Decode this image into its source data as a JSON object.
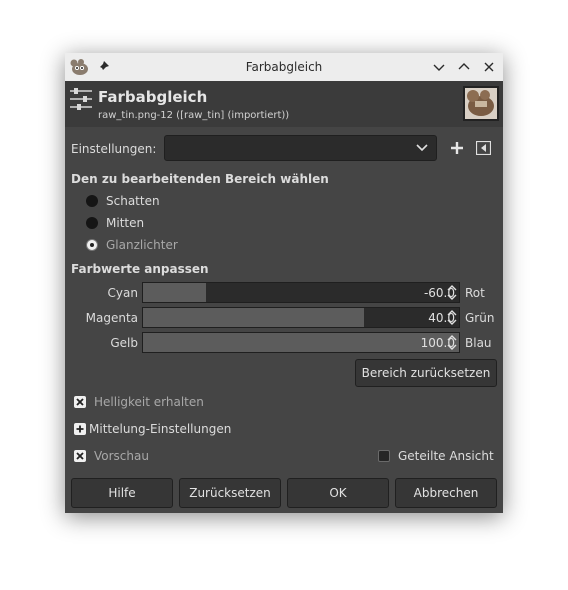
{
  "window": {
    "title": "Farbabgleich"
  },
  "header": {
    "title": "Farbabgleich",
    "subtitle": "raw_tin.png-12 ([raw_tin] (importiert))"
  },
  "presets": {
    "label": "Einstellungen:",
    "value": ""
  },
  "range": {
    "heading": "Den zu bearbeitenden Bereich wählen",
    "options": [
      "Schatten",
      "Mitten",
      "Glanzlichter"
    ],
    "selected": "Glanzlichter"
  },
  "levels": {
    "heading": "Farbwerte anpassen",
    "sliders": [
      {
        "left": "Cyan",
        "right": "Rot",
        "value": "-60.0",
        "fraction": 0.2
      },
      {
        "left": "Magenta",
        "right": "Grün",
        "value": "40.0",
        "fraction": 0.7
      },
      {
        "left": "Gelb",
        "right": "Blau",
        "value": "100.0",
        "fraction": 1.0
      }
    ],
    "reset_range": "Bereich zurücksetzen"
  },
  "options": {
    "preserve_luminosity": {
      "label": "Helligkeit erhalten",
      "checked": true
    },
    "blending": "Mittelung-Einstellungen",
    "preview": {
      "label": "Vorschau",
      "checked": true
    },
    "split_view": {
      "label": "Geteilte Ansicht",
      "checked": false
    }
  },
  "buttons": {
    "help": "Hilfe",
    "reset": "Zurücksetzen",
    "ok": "OK",
    "cancel": "Abbrechen"
  },
  "colors": {
    "window_bg": "#454545",
    "header_bg": "#3b3b3b",
    "titlebar_bg": "#ededed",
    "field_bg": "#2b2b2b",
    "slider_fill": "#5c5c5c"
  }
}
